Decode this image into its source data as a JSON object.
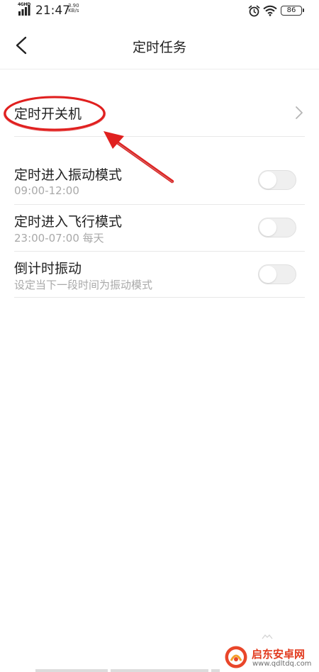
{
  "status_bar": {
    "network": "4GHD",
    "time": "21:47",
    "speed_value": "3.90",
    "speed_unit": "KB/s",
    "battery": "86",
    "icons": [
      "signal-icon",
      "alarm-icon",
      "wifi-icon",
      "battery-icon"
    ]
  },
  "header": {
    "title": "定时任务",
    "back_icon": "chevron-left-icon"
  },
  "rows": [
    {
      "title": "定时开关机",
      "type": "link",
      "icon": "chevron-right-icon"
    },
    {
      "title": "定时进入振动模式",
      "subtitle": "09:00-12:00",
      "type": "toggle",
      "enabled": false
    },
    {
      "title": "定时进入飞行模式",
      "subtitle": "23:00-07:00 每天",
      "type": "toggle",
      "enabled": false
    },
    {
      "title": "倒计时振动",
      "subtitle": "设定当下一段时间为振动模式",
      "type": "toggle",
      "enabled": false
    }
  ],
  "annotation": {
    "color": "#e0201f",
    "shapes": [
      "ellipse-annotation",
      "arrow-annotation"
    ]
  },
  "watermark": {
    "title": "启东安卓网",
    "url": "www.qdltdq.com",
    "color": "#e23b1f"
  }
}
